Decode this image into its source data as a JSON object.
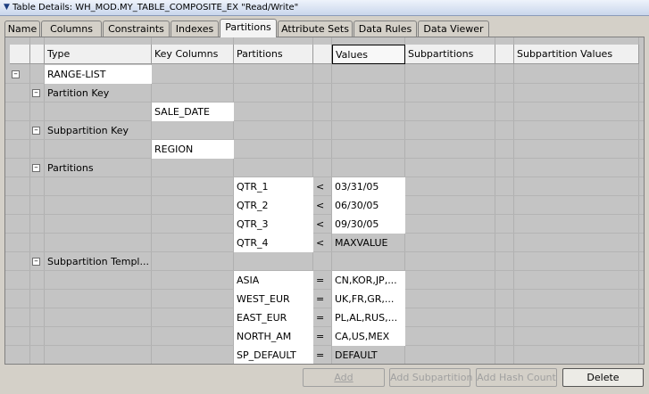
{
  "window": {
    "title": "Table Details: WH_MOD.MY_TABLE_COMPOSITE_EX \"Read/Write\""
  },
  "tabs": [
    {
      "label": "Name"
    },
    {
      "label": "Columns"
    },
    {
      "label": "Constraints"
    },
    {
      "label": "Indexes"
    },
    {
      "label": "Partitions",
      "active": true
    },
    {
      "label": "Attribute Sets"
    },
    {
      "label": "Data Rules"
    },
    {
      "label": "Data Viewer"
    }
  ],
  "grid": {
    "headers": {
      "type": "Type",
      "key_columns": "Key Columns",
      "partitions": "Partitions",
      "values": "Values",
      "subpartitions": "Subpartitions",
      "subpartition_values": "Subpartition Values"
    },
    "type_value": "RANGE-LIST",
    "partition_key": {
      "label": "Partition Key",
      "column": "SALE_DATE"
    },
    "subpartition_key": {
      "label": "Subpartition Key",
      "column": "REGION"
    },
    "partitions": {
      "label": "Partitions",
      "rows": [
        {
          "name": "QTR_1",
          "op": "<",
          "value": "03/31/05"
        },
        {
          "name": "QTR_2",
          "op": "<",
          "value": "06/30/05"
        },
        {
          "name": "QTR_3",
          "op": "<",
          "value": "09/30/05"
        },
        {
          "name": "QTR_4",
          "op": "<",
          "value": "MAXVALUE"
        }
      ]
    },
    "subpartition_template": {
      "label": "Subpartition Templ...",
      "rows": [
        {
          "name": "ASIA",
          "op": "=",
          "value": "CN,KOR,JP,..."
        },
        {
          "name": "WEST_EUR",
          "op": "=",
          "value": "UK,FR,GR,..."
        },
        {
          "name": "EAST_EUR",
          "op": "=",
          "value": "PL,AL,RUS,..."
        },
        {
          "name": "NORTH_AM",
          "op": "=",
          "value": "CA,US,MEX"
        },
        {
          "name": "SP_DEFAULT",
          "op": "=",
          "value": "DEFAULT"
        }
      ]
    }
  },
  "buttons": {
    "add": "Add",
    "add_subpartition": "Add Subpartition",
    "add_hash_count": "Add Hash Count",
    "delete": "Delete"
  }
}
